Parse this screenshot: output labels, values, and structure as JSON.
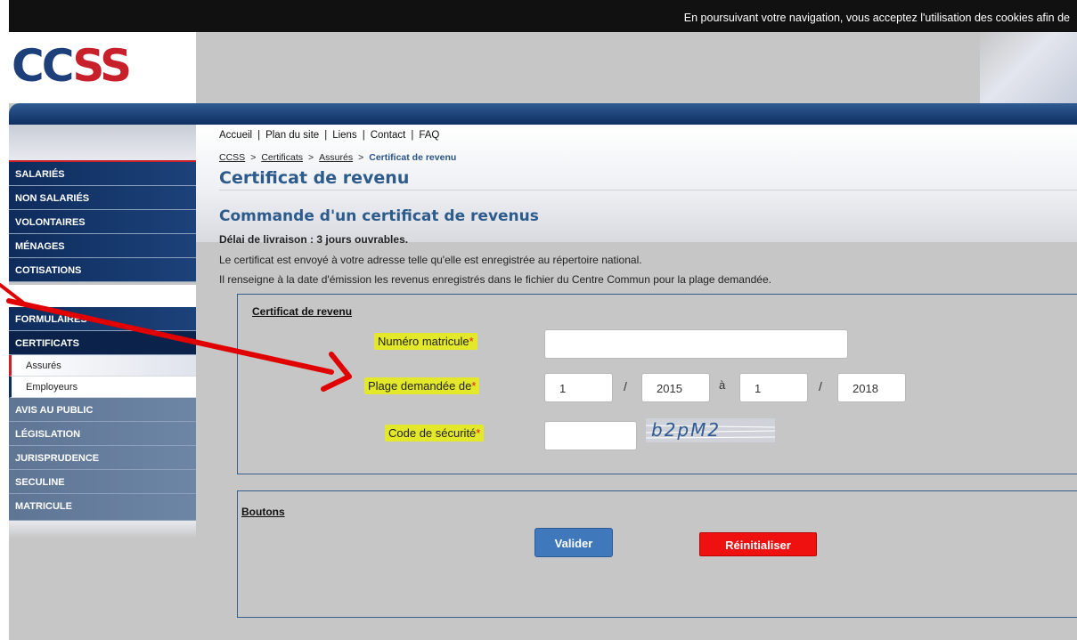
{
  "cookie_banner": {
    "text": "En poursuivant votre navigation, vous acceptez l'utilisation des cookies afin de"
  },
  "logo": {
    "part1": "CC",
    "part2": "SS"
  },
  "top_links": [
    "Accueil",
    "Plan du site",
    "Liens",
    "Contact",
    "FAQ"
  ],
  "breadcrumb": [
    "CCSS",
    "Certificats",
    "Assurés",
    "Certificat de revenu"
  ],
  "sidebar": {
    "main_items": [
      "SALARIÉS",
      "NON SALARIÉS",
      "VOLONTAIRES",
      "MÉNAGES",
      "COTISATIONS"
    ],
    "section_items": [
      "FORMULAIRES",
      "CERTIFICATS"
    ],
    "sub_items": [
      "Assurés",
      "Employeurs"
    ],
    "lower_items": [
      "AVIS AU PUBLIC",
      "LÉGISLATION",
      "JURISPRUDENCE",
      "SECULINE",
      "MATRICULE"
    ]
  },
  "page": {
    "title": "Certificat de revenu",
    "subtitle": "Commande d'un certificat de revenus",
    "delay": "Délai de livraison : 3 jours ouvrables.",
    "info1": "Le certificat est envoyé à votre adresse telle qu'elle est enregistrée au répertoire national.",
    "info2": "Il renseigne à la date d'émission les revenus enregistrés dans le fichier du Centre Commun pour la plage demandée."
  },
  "form": {
    "legend": "Certificat de revenu",
    "matricule_label": "Numéro matricule",
    "plage_label": "Plage demandée de",
    "code_label": "Code de sécurité",
    "required_mark": "*",
    "matricule_value": "",
    "from_month": "1",
    "from_year": "2015",
    "range_sep": "à",
    "to_month": "1",
    "to_year": "2018",
    "date_sep": "/",
    "security_code_value": "",
    "captcha_text": "b2pM2"
  },
  "buttons": {
    "legend": "Boutons",
    "submit": "Valider",
    "reset": "Réinitialiser"
  },
  "colors": {
    "accent_blue": "#2c5b8c",
    "nav_dark": "#0e2c5c",
    "highlight": "#e3e82a",
    "submit_button": "#3f79bc",
    "reset_button": "#ef1010",
    "annotation_arrow": "#e00000"
  }
}
